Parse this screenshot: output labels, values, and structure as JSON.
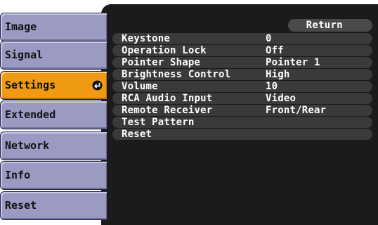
{
  "tabs": [
    {
      "label": "Image",
      "selected": false
    },
    {
      "label": "Signal",
      "selected": false
    },
    {
      "label": "Settings",
      "selected": true
    },
    {
      "label": "Extended",
      "selected": false
    },
    {
      "label": "Network",
      "selected": false
    },
    {
      "label": "Info",
      "selected": false
    },
    {
      "label": "Reset",
      "selected": false
    }
  ],
  "selected_tab_icon": "enter-icon",
  "return_label": "Return",
  "settings": [
    {
      "label": "Keystone",
      "value": "0"
    },
    {
      "label": "Operation Lock",
      "value": "Off"
    },
    {
      "label": "Pointer Shape",
      "value": "Pointer 1"
    },
    {
      "label": "Brightness Control",
      "value": "High"
    },
    {
      "label": "Volume",
      "value": "10"
    },
    {
      "label": "RCA Audio Input",
      "value": "Video"
    },
    {
      "label": "Remote Receiver",
      "value": "Front/Rear"
    },
    {
      "label": "Test Pattern",
      "value": ""
    },
    {
      "label": "Reset",
      "value": ""
    }
  ],
  "colors": {
    "panel_bg": "#1b1b1b",
    "tab_bg": "#9a9ac3",
    "tab_selected_bg": "#f09a14",
    "row_bg": "#3a3a3a",
    "text": "#ffffff"
  }
}
